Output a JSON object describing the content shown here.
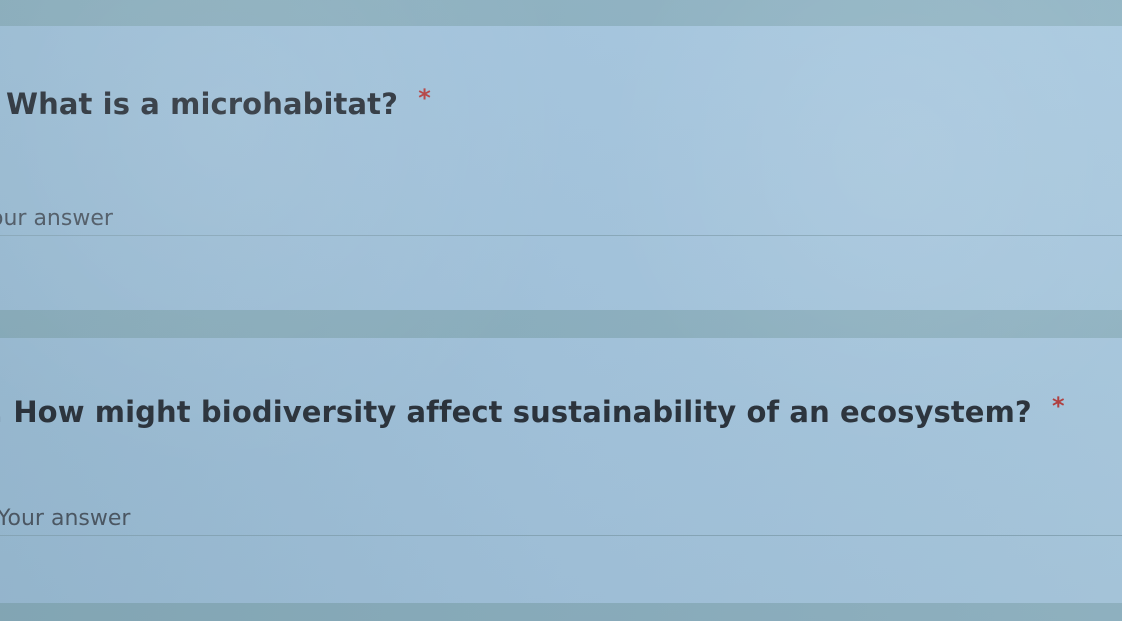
{
  "form": {
    "questions": [
      {
        "text": "What is a microhabitat?",
        "required_mark": "*",
        "answer_placeholder": "our answer"
      },
      {
        "text": ". How might biodiversity affect sustainability of an ecosystem?",
        "required_mark": "*",
        "answer_placeholder": "Your answer"
      }
    ]
  }
}
